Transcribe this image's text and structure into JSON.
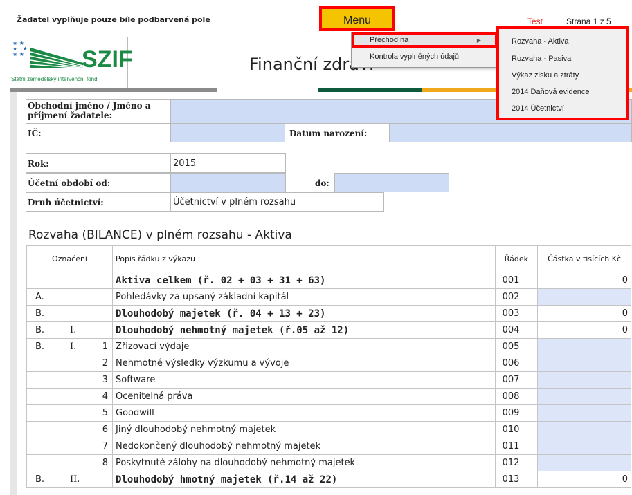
{
  "top": {
    "note": "Žadatel vyplňuje pouze bíle podbarvená pole",
    "menu_label": "Menu",
    "test_label": "Test",
    "page_info": "Strana 1 z 5"
  },
  "header": {
    "logo_text": "SZIF",
    "fund_name": "Státní zemědělský intervenční fond",
    "title": "Finanční zdraví"
  },
  "colors": {
    "accent_yellow": "#f5c400",
    "highlight_red": "#ff0000",
    "input_blue": "#cfdcf5",
    "brand_green": "#1b8a45"
  },
  "form": {
    "name_label": "Obchodní jméno / Jméno a příjmení žadatele:",
    "ic_label": "IČ:",
    "birth_label": "Datum narození:",
    "year_label": "Rok:",
    "year_value": "2015",
    "period_from_label": "Účetní období od:",
    "period_to_label": "do:",
    "type_label": "Druh účetnictví:",
    "type_value": "Účetnictví v plném rozsahu"
  },
  "section": {
    "title": "Rozvaha (BILANCE) v plném rozsahu - Aktiva"
  },
  "table": {
    "headers": {
      "oznaceni": "Označení",
      "popis": "Popis řádku z výkazu",
      "radek": "Řádek",
      "castka": "Částka v tisících Kč"
    },
    "rows": [
      {
        "o1": "",
        "o2": "",
        "o3": "",
        "desc": "Aktiva celkem (ř. 02 + 03 + 31 + 63)",
        "bold": true,
        "radek": "001",
        "castka": "0",
        "input": false
      },
      {
        "o1": "A.",
        "o2": "",
        "o3": "",
        "desc": "Pohledávky za upsaný základní kapitál",
        "bold": false,
        "radek": "002",
        "castka": "",
        "input": true
      },
      {
        "o1": "B.",
        "o2": "",
        "o3": "",
        "desc": "Dlouhodobý majetek (ř. 04 + 13 + 23)",
        "bold": true,
        "radek": "003",
        "castka": "0",
        "input": false
      },
      {
        "o1": "B.",
        "o2": "I.",
        "o3": "",
        "desc": "Dlouhodobý nehmotný majetek (ř.05 až 12)",
        "bold": true,
        "radek": "004",
        "castka": "0",
        "input": false
      },
      {
        "o1": "B.",
        "o2": "I.",
        "o3": "1",
        "desc": "Zřizovací výdaje",
        "bold": false,
        "radek": "005",
        "castka": "",
        "input": true
      },
      {
        "o1": "",
        "o2": "",
        "o3": "2",
        "desc": "Nehmotné výsledky výzkumu a vývoje",
        "bold": false,
        "radek": "006",
        "castka": "",
        "input": true
      },
      {
        "o1": "",
        "o2": "",
        "o3": "3",
        "desc": "Software",
        "bold": false,
        "radek": "007",
        "castka": "",
        "input": true
      },
      {
        "o1": "",
        "o2": "",
        "o3": "4",
        "desc": "Ocenitelná práva",
        "bold": false,
        "radek": "008",
        "castka": "",
        "input": true
      },
      {
        "o1": "",
        "o2": "",
        "o3": "5",
        "desc": "Goodwill",
        "bold": false,
        "radek": "009",
        "castka": "",
        "input": true
      },
      {
        "o1": "",
        "o2": "",
        "o3": "6",
        "desc": "Jiný dlouhodobý nehmotný majetek",
        "bold": false,
        "radek": "010",
        "castka": "",
        "input": true
      },
      {
        "o1": "",
        "o2": "",
        "o3": "7",
        "desc": "Nedokončený dlouhodobý nehmotný majetek",
        "bold": false,
        "radek": "011",
        "castka": "",
        "input": true
      },
      {
        "o1": "",
        "o2": "",
        "o3": "8",
        "desc": "Poskytnuté zálohy na dlouhodobý nehmotný majetek",
        "bold": false,
        "radek": "012",
        "castka": "",
        "input": true
      },
      {
        "o1": "B.",
        "o2": "II.",
        "o3": "",
        "desc": "Dlouhodobý hmotný majetek (ř.14 až 22)",
        "bold": true,
        "radek": "013",
        "castka": "0",
        "input": false
      }
    ]
  },
  "dropdown": {
    "items": [
      {
        "label": "Přechod na",
        "has_submenu": true
      },
      {
        "label": "Kontrola vyplněných údajů",
        "has_submenu": false
      }
    ],
    "submenu": [
      "Rozvaha - Aktiva",
      "Rozvaha - Pasiva",
      "Výkaz zisku a ztráty",
      "2014 Daňová evidence",
      "2014 Účetnictví"
    ]
  }
}
